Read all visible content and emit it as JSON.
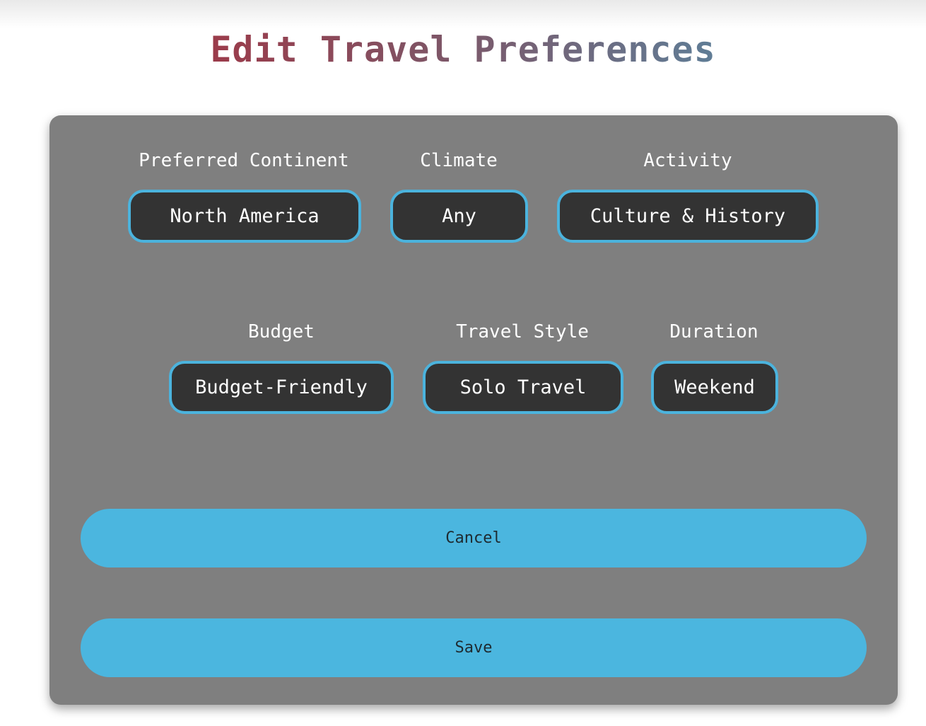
{
  "page": {
    "title": "Edit Travel Preferences"
  },
  "fields": {
    "continent": {
      "label": "Preferred Continent",
      "value": "North America"
    },
    "climate": {
      "label": "Climate",
      "value": "Any"
    },
    "activity": {
      "label": "Activity",
      "value": "Culture & History"
    },
    "budget": {
      "label": "Budget",
      "value": "Budget-Friendly"
    },
    "style": {
      "label": "Travel Style",
      "value": "Solo Travel"
    },
    "duration": {
      "label": "Duration",
      "value": "Weekend"
    }
  },
  "actions": {
    "cancel_label": "Cancel",
    "save_label": "Save"
  },
  "colors": {
    "card_background": "#7f7f7f",
    "pill_background": "#333333",
    "accent": "#4bb6df",
    "title_gradient_start": "#9b3b4a",
    "title_gradient_end": "#5f7d96"
  }
}
